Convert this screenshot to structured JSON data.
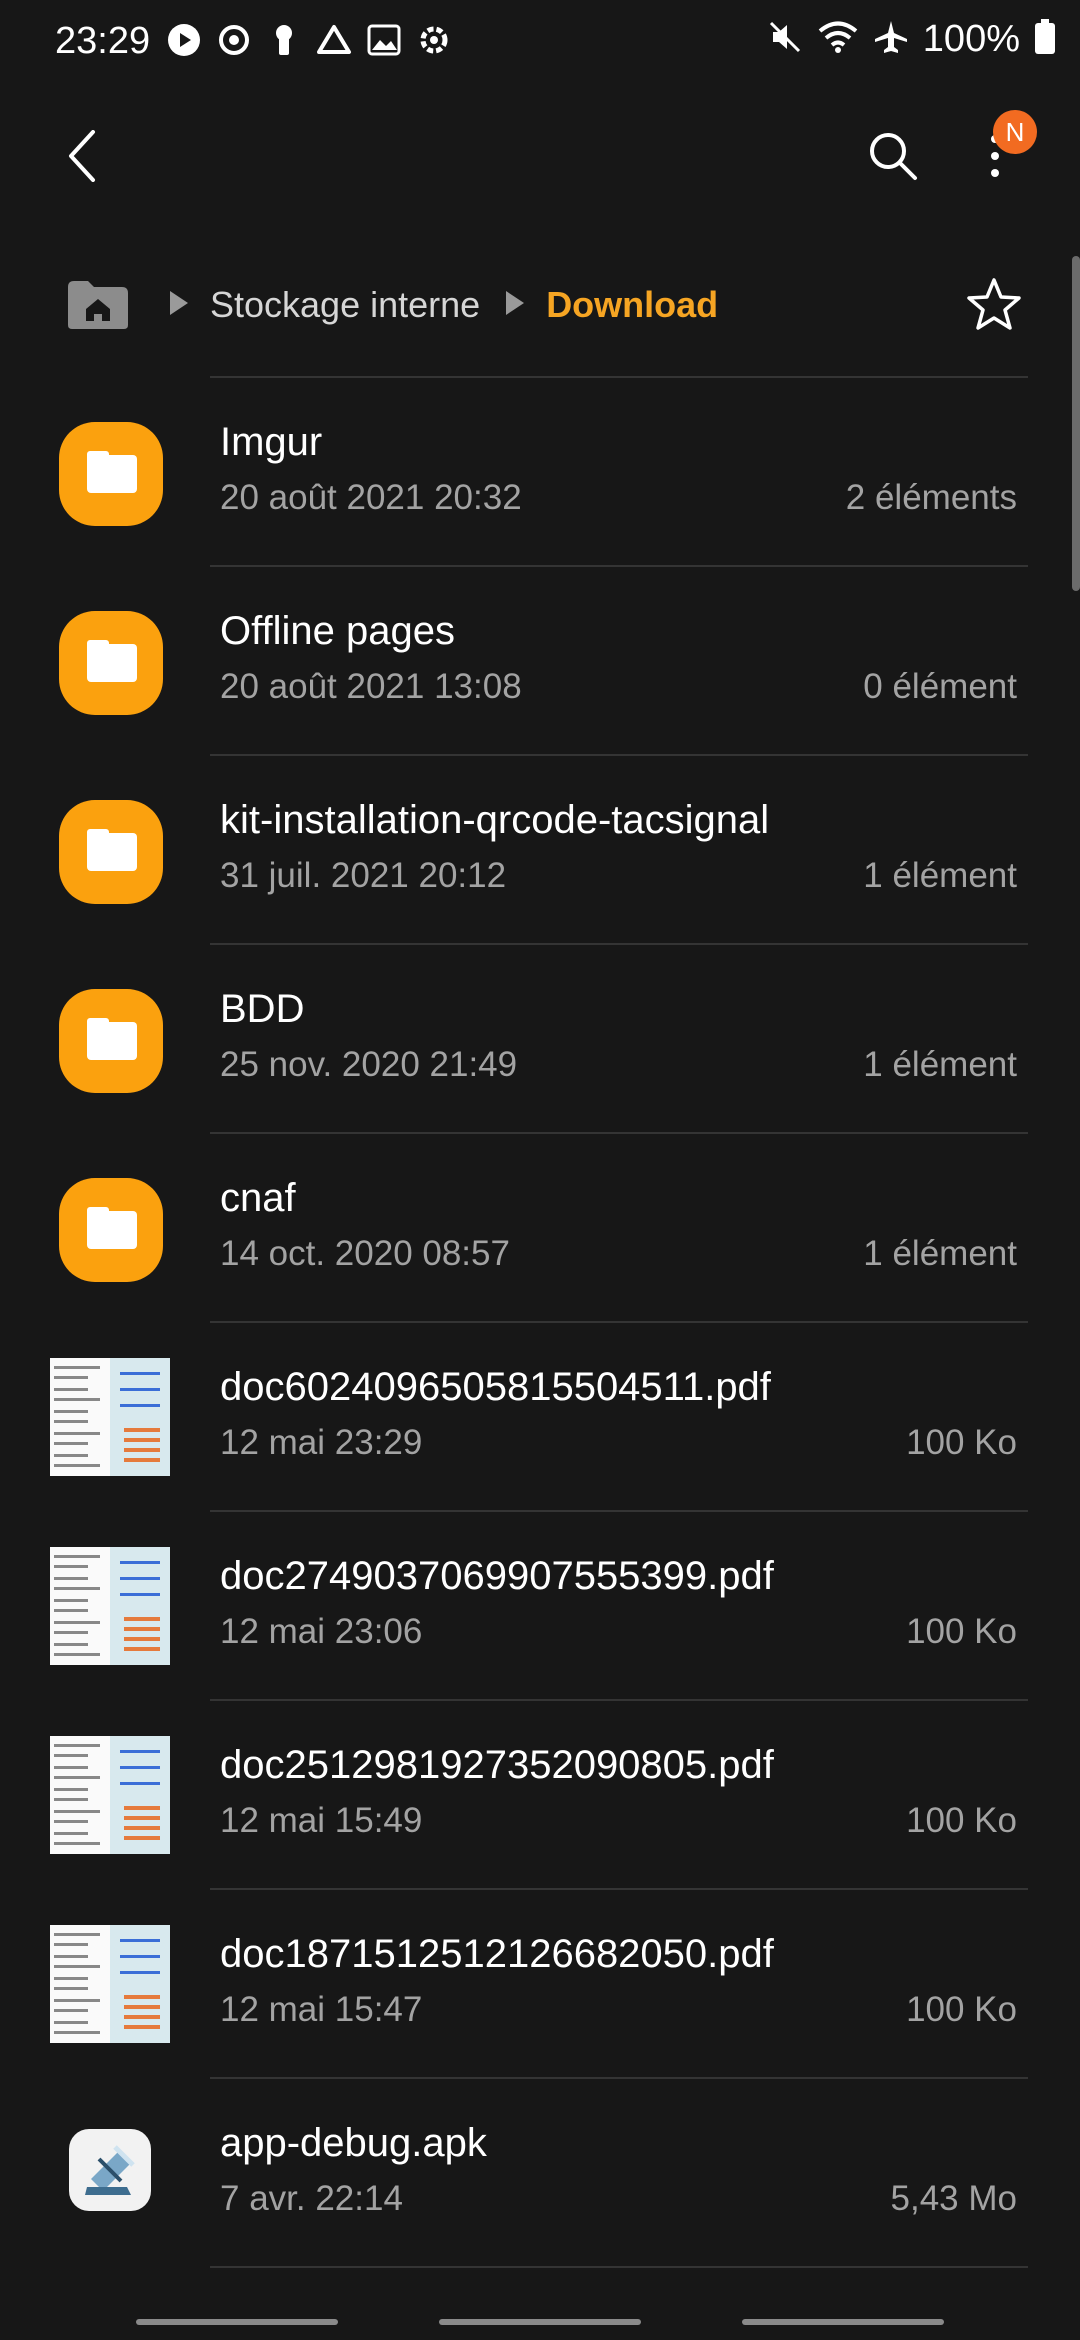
{
  "status_bar": {
    "time": "23:29",
    "battery": "100%",
    "left_icons": [
      "play-icon",
      "sync-icon",
      "keyhole-icon",
      "drive-icon",
      "image-icon",
      "settings-icon"
    ],
    "right_icons": [
      "mute-icon",
      "wifi-icon",
      "airplane-icon",
      "battery-icon"
    ]
  },
  "app_bar": {
    "notification_badge": "N",
    "back_icon": "back-arrow-icon",
    "search_icon": "search-icon",
    "more_icon": "more-vertical-icon"
  },
  "breadcrumb": {
    "home_icon": "home-icon",
    "items": [
      "Stockage interne",
      "Download"
    ],
    "favorite_icon": "star-outline-icon"
  },
  "colors": {
    "accent": "#f6a523",
    "folder": "#fba10e",
    "badge": "#f26b21",
    "background": "#171717"
  },
  "files": [
    {
      "name": "Imgur",
      "date": "20 août 2021 20:32",
      "meta": "2 éléments",
      "type": "folder"
    },
    {
      "name": "Offline pages",
      "date": "20 août 2021 13:08",
      "meta": "0 élément",
      "type": "folder"
    },
    {
      "name": "kit-installation-qrcode-tacsignal",
      "date": "31 juil. 2021 20:12",
      "meta": "1 élément",
      "type": "folder"
    },
    {
      "name": "BDD",
      "date": "25 nov. 2020 21:49",
      "meta": "1 élément",
      "type": "folder"
    },
    {
      "name": "cnaf",
      "date": "14 oct. 2020 08:57",
      "meta": "1 élément",
      "type": "folder"
    },
    {
      "name": "doc6024096505815504511.pdf",
      "date": "12 mai 23:29",
      "meta": "100 Ko",
      "type": "pdf"
    },
    {
      "name": "doc2749037069907555399.pdf",
      "date": "12 mai 23:06",
      "meta": "100 Ko",
      "type": "pdf"
    },
    {
      "name": "doc2512981927352090805.pdf",
      "date": "12 mai 15:49",
      "meta": "100 Ko",
      "type": "pdf"
    },
    {
      "name": "doc1871512512126682050.pdf",
      "date": "12 mai 15:47",
      "meta": "100 Ko",
      "type": "pdf"
    },
    {
      "name": "app-debug.apk",
      "date": "7 avr. 22:14",
      "meta": "5,43 Mo",
      "type": "apk"
    }
  ]
}
